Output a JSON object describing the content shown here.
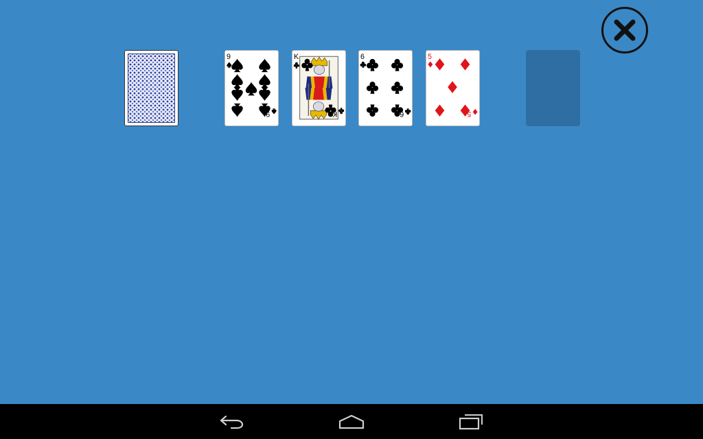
{
  "table": {
    "background_color": "#3b88c6",
    "empty_slot_color": "#2f6ea3"
  },
  "close_button": {
    "icon": "close-icon"
  },
  "stock_pile": {
    "icon": "card-back"
  },
  "cards": [
    {
      "rank": "9",
      "suit": "spades",
      "color": "#000000"
    },
    {
      "rank": "K",
      "suit": "clubs",
      "color": "#000000"
    },
    {
      "rank": "6",
      "suit": "clubs",
      "color": "#000000"
    },
    {
      "rank": "5",
      "suit": "diamonds",
      "color": "#e0141b"
    }
  ],
  "nav_bar": {
    "back_icon": "back-arrow-icon",
    "home_icon": "home-icon",
    "recents_icon": "recent-apps-icon"
  }
}
